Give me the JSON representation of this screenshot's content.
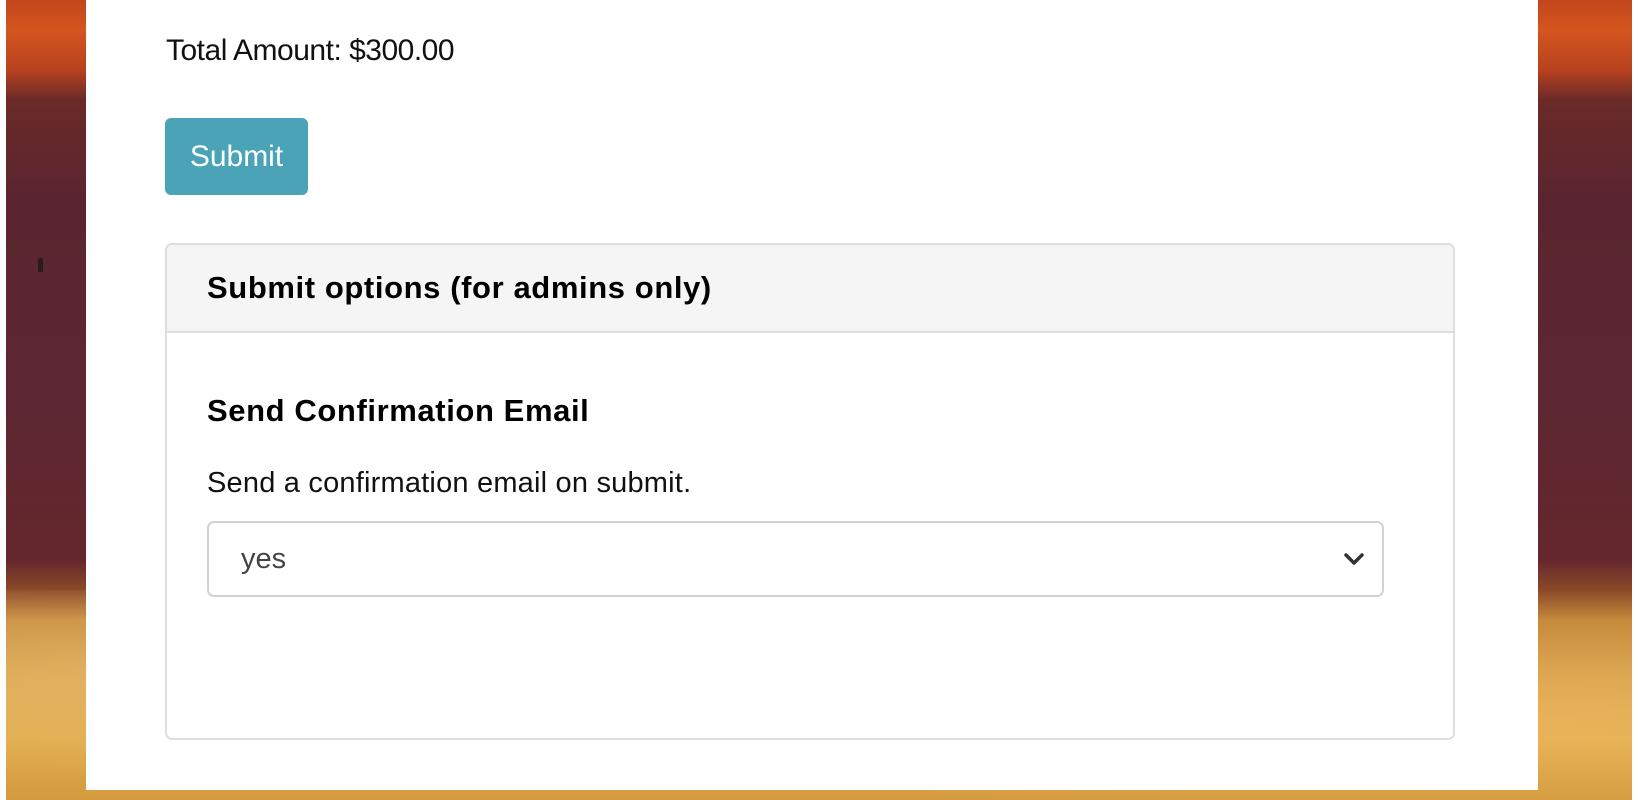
{
  "form": {
    "total_amount_label": "Total Amount: $300.00",
    "submit_label": "Submit"
  },
  "admin_panel": {
    "title": "Submit options (for admins only)",
    "confirmation": {
      "title": "Send Confirmation Email",
      "description": "Send a confirmation email on submit.",
      "selected_value": "yes"
    }
  },
  "colors": {
    "submit_button": "#4aa3b6",
    "panel_header_bg": "#f5f5f5",
    "panel_border": "#dedede"
  },
  "icons": {
    "select_chevron": "chevron-down-icon"
  }
}
